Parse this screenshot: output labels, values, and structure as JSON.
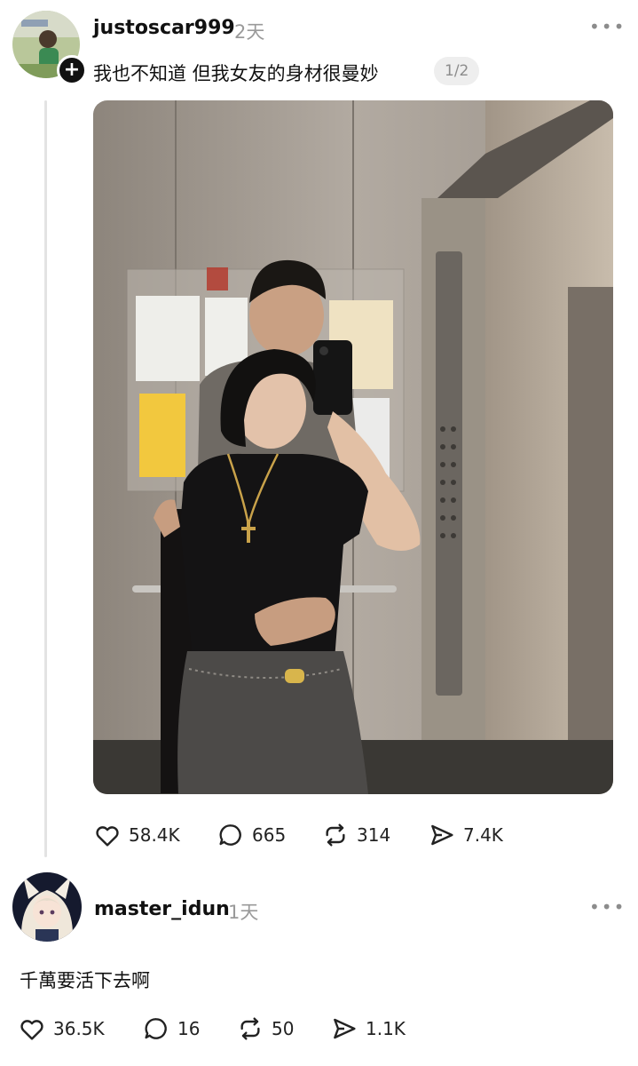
{
  "post": {
    "username": "justoscar999",
    "time": "2天",
    "text": "我也不知道 但我女友的身材很曼妙",
    "image_counter": "1/2",
    "more_icon": "more-horizontal-icon",
    "stats": {
      "likes": "58.4K",
      "comments": "665",
      "reposts": "314",
      "shares": "7.4K"
    }
  },
  "reply": {
    "username": "master_idun",
    "time": "1天",
    "text": "千萬要活下去啊",
    "stats": {
      "likes": "36.5K",
      "comments": "16",
      "reposts": "50",
      "shares": "1.1K"
    }
  },
  "colors": {
    "text": "#111111",
    "muted": "#9a9a9a",
    "thread_line": "#e3e3e3"
  }
}
